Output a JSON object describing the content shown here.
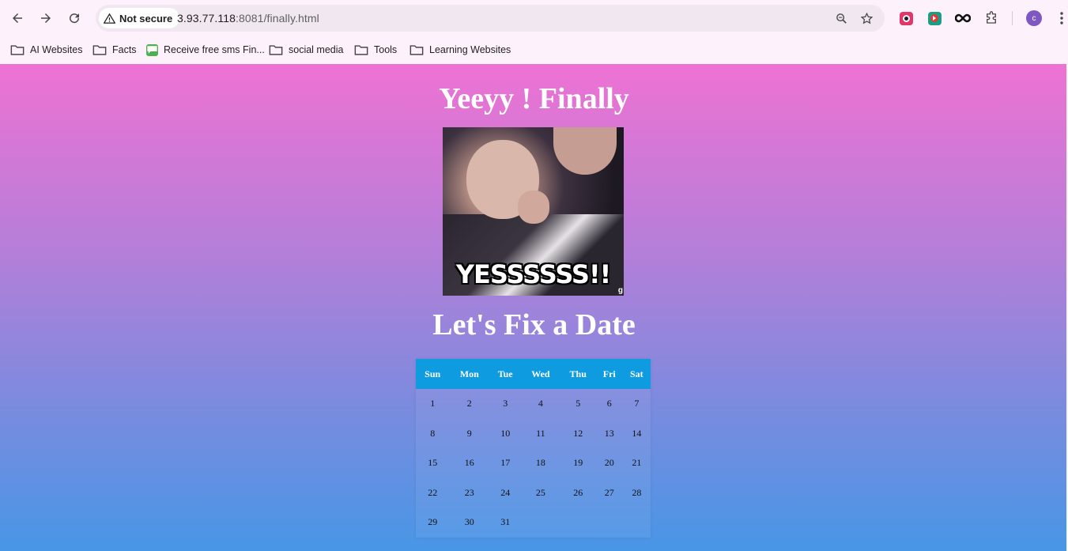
{
  "browser": {
    "security_label": "Not secure",
    "url_host": "3.93.77.118",
    "url_rest": ":8081/finally.html",
    "profile_initial": "c"
  },
  "bookmarks": [
    {
      "label": "AI Websites",
      "icon": "folder-icon"
    },
    {
      "label": "Facts",
      "icon": "folder-icon"
    },
    {
      "label": "Receive free sms Fin...",
      "icon": "sms-site-icon"
    },
    {
      "label": "social media",
      "icon": "folder-icon"
    },
    {
      "label": "Tools",
      "icon": "folder-icon"
    },
    {
      "label": "Learning Websites",
      "icon": "folder-icon"
    }
  ],
  "page": {
    "title": "Yeeyy ! Finally",
    "gif_caption": "YESSSSSS!!",
    "gif_watermark": "g",
    "subtitle": "Let's Fix a Date"
  },
  "calendar": {
    "days": [
      "Sun",
      "Mon",
      "Tue",
      "Wed",
      "Thu",
      "Fri",
      "Sat"
    ],
    "weeks": [
      [
        "1",
        "2",
        "3",
        "4",
        "5",
        "6",
        "7"
      ],
      [
        "8",
        "9",
        "10",
        "11",
        "12",
        "13",
        "14"
      ],
      [
        "15",
        "16",
        "17",
        "18",
        "19",
        "20",
        "21"
      ],
      [
        "22",
        "23",
        "24",
        "25",
        "26",
        "27",
        "28"
      ],
      [
        "29",
        "30",
        "31",
        "",
        "",
        "",
        ""
      ]
    ],
    "header_color": "#0f9be0"
  },
  "colors": {
    "gradient_top": "#ee72d3",
    "gradient_bottom": "#4896e6"
  }
}
